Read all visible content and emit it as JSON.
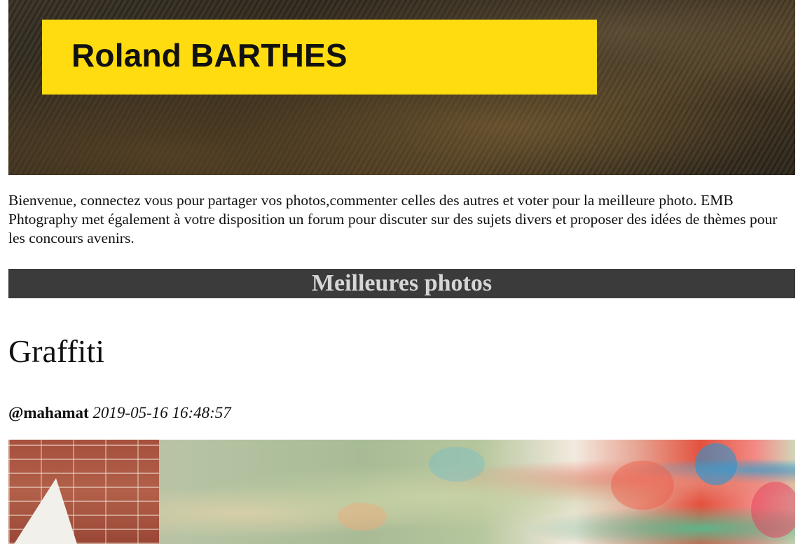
{
  "header": {
    "title": "Roland BARTHES"
  },
  "intro": {
    "text": "Bienvenue, connectez vous pour partager vos photos,commenter celles des autres et voter pour la meilleure photo. EMB Phtography met également à votre disposition un forum pour discuter sur des sujets divers et proposer des idées de thèmes pour les concours avenirs."
  },
  "section": {
    "title": "Meilleures photos"
  },
  "post": {
    "title": "Graffiti",
    "author": "@mahamat",
    "date": "2019-05-16 16:48:57"
  },
  "colors": {
    "banner_accent": "#ffdc0f",
    "section_bar": "#3b3b3b",
    "section_text": "#d6d6d6"
  }
}
